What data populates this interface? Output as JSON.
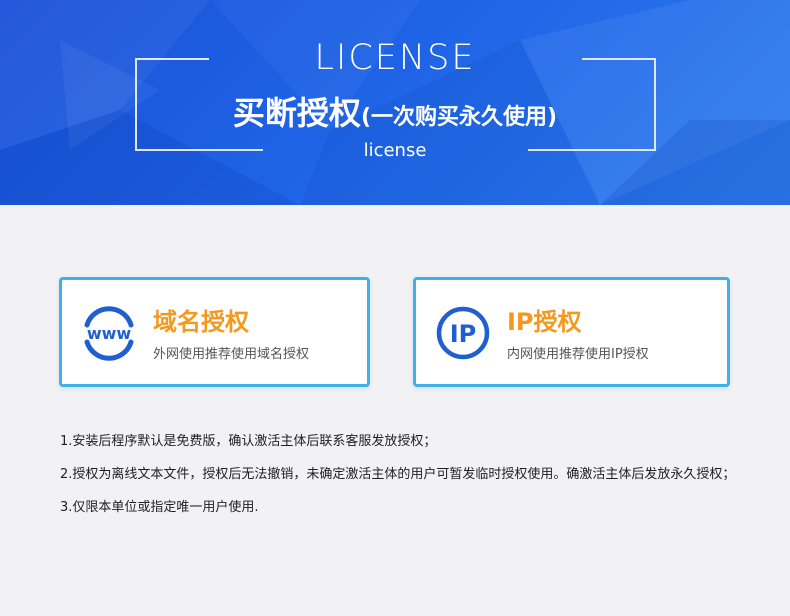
{
  "hero": {
    "title_en": "LICENSE",
    "title_main": "买断授权",
    "title_sub": "(一次购买永久使用)",
    "subtitle": "license"
  },
  "options": [
    {
      "icon": "www-globe-icon",
      "title": "域名授权",
      "desc": "外网使用推荐使用域名授权",
      "icon_text": "www"
    },
    {
      "icon": "ip-circle-icon",
      "title": "IP授权",
      "desc": "内网使用推荐使用IP授权",
      "icon_text": "IP"
    }
  ],
  "notes": [
    "1.安装后程序默认是免费版，确认激活主体后联系客服发放授权；",
    "2.授权为离线文本文件，授权后无法撤销，未确定激活主体的用户可暂发临时授权使用。确激活主体后发放永久授权；",
    "3.仅限本单位或指定唯一用户使用."
  ],
  "colors": {
    "banner_blue": "#1e63e6",
    "card_border": "#3fb0e8",
    "accent_orange": "#f39a1e",
    "icon_blue": "#1f5fd0"
  }
}
